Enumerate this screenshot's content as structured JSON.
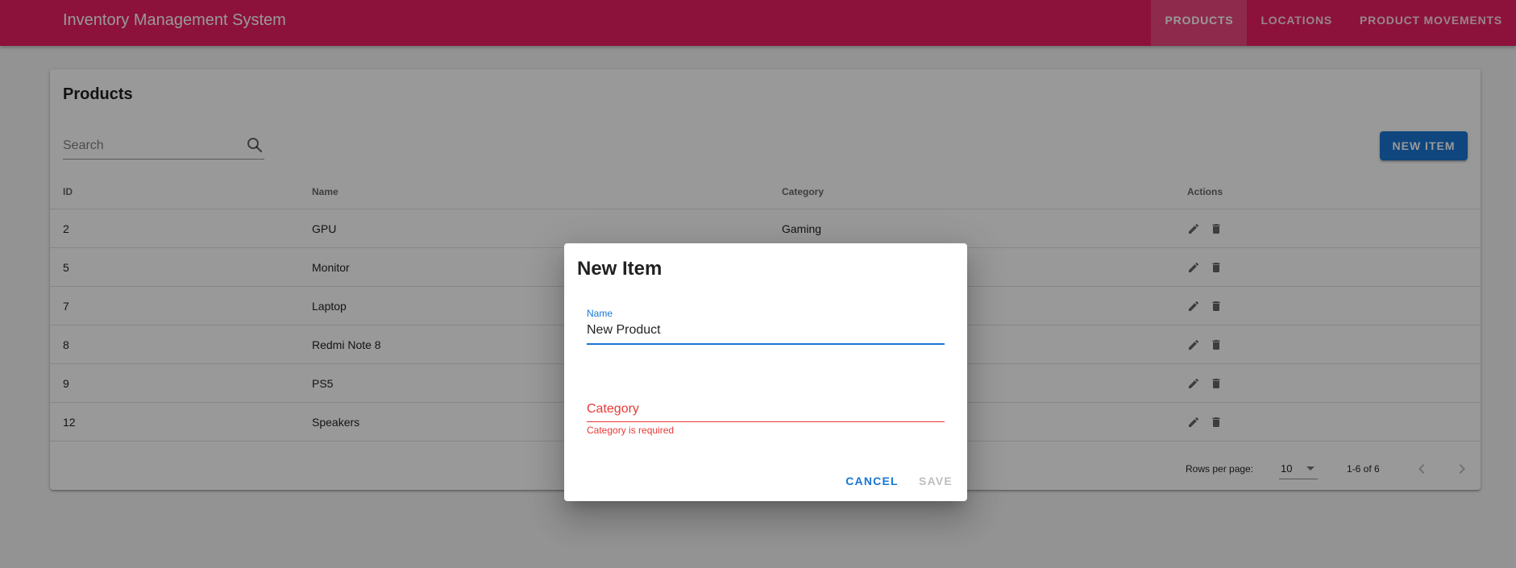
{
  "app": {
    "title": "Inventory Management System"
  },
  "nav": {
    "items": [
      {
        "label": "PRODUCTS",
        "active": true
      },
      {
        "label": "LOCATIONS",
        "active": false
      },
      {
        "label": "PRODUCT MOVEMENTS",
        "active": false
      }
    ]
  },
  "products": {
    "title": "Products",
    "search": {
      "placeholder": "Search",
      "value": ""
    },
    "new_button": "NEW ITEM",
    "columns": {
      "id": "ID",
      "name": "Name",
      "category": "Category",
      "actions": "Actions"
    },
    "rows": [
      {
        "id": "2",
        "name": "GPU",
        "category": "Gaming"
      },
      {
        "id": "5",
        "name": "Monitor",
        "category": ""
      },
      {
        "id": "7",
        "name": "Laptop",
        "category": ""
      },
      {
        "id": "8",
        "name": "Redmi Note 8",
        "category": ""
      },
      {
        "id": "9",
        "name": "PS5",
        "category": ""
      },
      {
        "id": "12",
        "name": "Speakers",
        "category": ""
      }
    ],
    "pagination": {
      "rows_per_page_label": "Rows per page:",
      "rows_per_page": "10",
      "range": "1-6 of 6"
    }
  },
  "dialog": {
    "title": "New Item",
    "name_label": "Name",
    "name_value": "New Product",
    "category_placeholder": "Category",
    "category_value": "",
    "category_error": "Category is required",
    "cancel": "CANCEL",
    "save": "SAVE"
  },
  "colors": {
    "primary": "#e91e63",
    "accent": "#1976d2",
    "error": "#e53935"
  },
  "icons": {
    "search": "search-icon",
    "edit": "pencil-icon",
    "delete": "trash-icon",
    "dropdown": "caret-down-icon",
    "prev": "chevron-left-icon",
    "next": "chevron-right-icon"
  }
}
